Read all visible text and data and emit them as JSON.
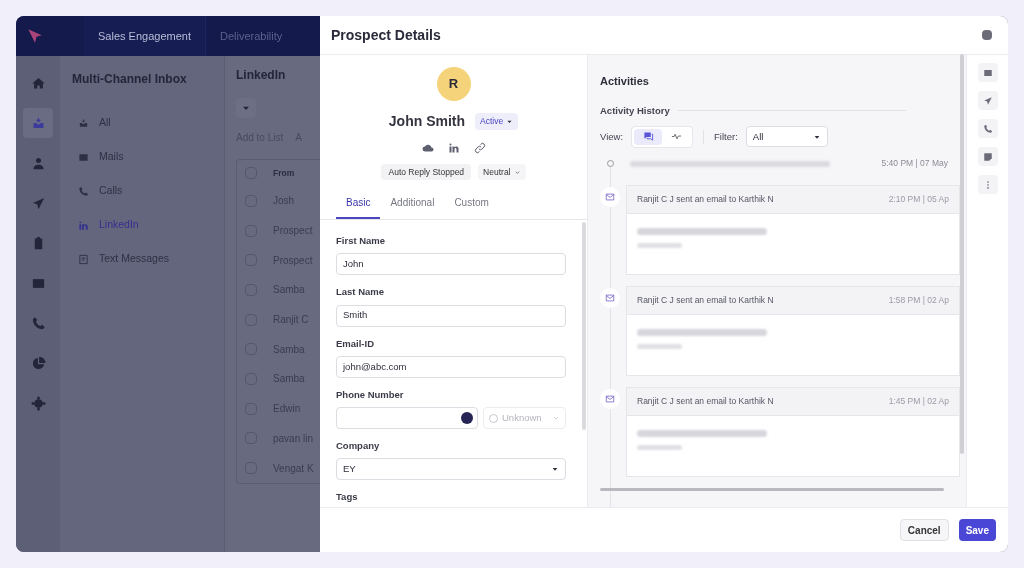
{
  "top_nav": {
    "tabs": [
      {
        "label": "Sales Engagement",
        "selected": true
      },
      {
        "label": "Deliverability",
        "selected": false
      }
    ]
  },
  "icon_rail": [
    {
      "kind": "home",
      "selected": false
    },
    {
      "kind": "inbox",
      "selected": true
    },
    {
      "kind": "person",
      "selected": false
    },
    {
      "kind": "send",
      "selected": false
    },
    {
      "kind": "clipboard",
      "selected": false
    },
    {
      "kind": "mail",
      "selected": false
    },
    {
      "kind": "phone",
      "selected": false
    },
    {
      "kind": "chart",
      "selected": false
    },
    {
      "kind": "gear",
      "selected": false
    }
  ],
  "inbox": {
    "title": "Multi-Channel Inbox",
    "items": [
      {
        "label": "All",
        "kind": "inbox",
        "selected": false
      },
      {
        "label": "Mails",
        "kind": "mail",
        "selected": false
      },
      {
        "label": "Calls",
        "kind": "phone",
        "selected": false
      },
      {
        "label": "LinkedIn",
        "kind": "linkedin",
        "selected": true
      },
      {
        "label": "Text Messages",
        "kind": "message",
        "selected": false
      }
    ]
  },
  "list_panel": {
    "title": "LinkedIn",
    "actions": [
      "Add to List",
      "A"
    ],
    "column": "From",
    "header_checked": false,
    "rows": [
      {
        "from": "Josh",
        "checked": false
      },
      {
        "from": "Prospect",
        "checked": false
      },
      {
        "from": "Prospect",
        "checked": false
      },
      {
        "from": "Samba",
        "checked": false
      },
      {
        "from": "Ranjit C",
        "checked": false
      },
      {
        "from": "Samba",
        "checked": false
      },
      {
        "from": "Samba",
        "checked": false
      },
      {
        "from": "Edwin",
        "checked": false
      },
      {
        "from": "pavan lin",
        "checked": false
      },
      {
        "from": "Vengat K",
        "checked": false
      }
    ]
  },
  "modal": {
    "title": "Prospect Details",
    "avatar": "R",
    "name": "John Smith",
    "status": "Active",
    "links": [
      {
        "kind": "cloud"
      },
      {
        "kind": "linkedin"
      },
      {
        "kind": "link"
      }
    ],
    "chip": "Auto Reply Stopped",
    "sentiment": "Neutral",
    "tabs": [
      {
        "label": "Basic",
        "selected": true
      },
      {
        "label": "Additional",
        "selected": false
      },
      {
        "label": "Custom",
        "selected": false
      }
    ],
    "fields": [
      {
        "kind": "text",
        "label": "First Name",
        "value": "John"
      },
      {
        "kind": "text",
        "label": "Last Name",
        "value": "Smith"
      },
      {
        "kind": "text",
        "label": "Email-ID",
        "value": "john@abc.com"
      },
      {
        "kind": "phone",
        "label": "Phone Number",
        "type_select": "Unknown"
      },
      {
        "kind": "select",
        "label": "Company",
        "value": "EY"
      },
      {
        "kind": "label",
        "label": "Tags"
      }
    ],
    "activities": {
      "title": "Activities",
      "history_title": "Activity History",
      "view_label": "View:",
      "views": [
        {
          "kind": "chat",
          "selected": true
        },
        {
          "kind": "pulse",
          "selected": false
        }
      ],
      "filter_label": "Filter:",
      "filter_value": "All",
      "first_event_time": "5:40 PM | 07 May",
      "events": [
        {
          "summary": "Ranjit C J sent an email to Karthik N",
          "time": "2:10 PM | 05 Ap"
        },
        {
          "summary": "Ranjit C J sent an email to Karthik N",
          "time": "1:58 PM | 02 Ap"
        },
        {
          "summary": "Ranjit C J sent an email to Karthik N",
          "time": "1:45 PM | 02 Ap"
        }
      ]
    },
    "side_actions": [
      {
        "kind": "mail"
      },
      {
        "kind": "send"
      },
      {
        "kind": "phone"
      },
      {
        "kind": "note"
      },
      {
        "kind": "more"
      }
    ],
    "buttons": {
      "cancel": "Cancel",
      "save": "Save"
    }
  }
}
